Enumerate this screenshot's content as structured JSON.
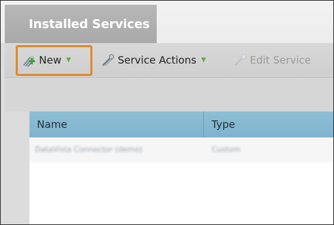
{
  "tabs": {
    "active_label": "Installed Services"
  },
  "toolbar": {
    "new_label": "New",
    "service_actions_label": "Service Actions",
    "edit_service_label": "Edit Service",
    "caret_glyph": "▼"
  },
  "grid": {
    "columns": [
      "Name",
      "Type"
    ],
    "rows": [
      {
        "name": "DataVista Connector (demo)",
        "type": "Custom"
      }
    ]
  },
  "colors": {
    "highlight": "#e0892b",
    "header_bg": "#8ebfd6",
    "caret": "#61a83b"
  }
}
